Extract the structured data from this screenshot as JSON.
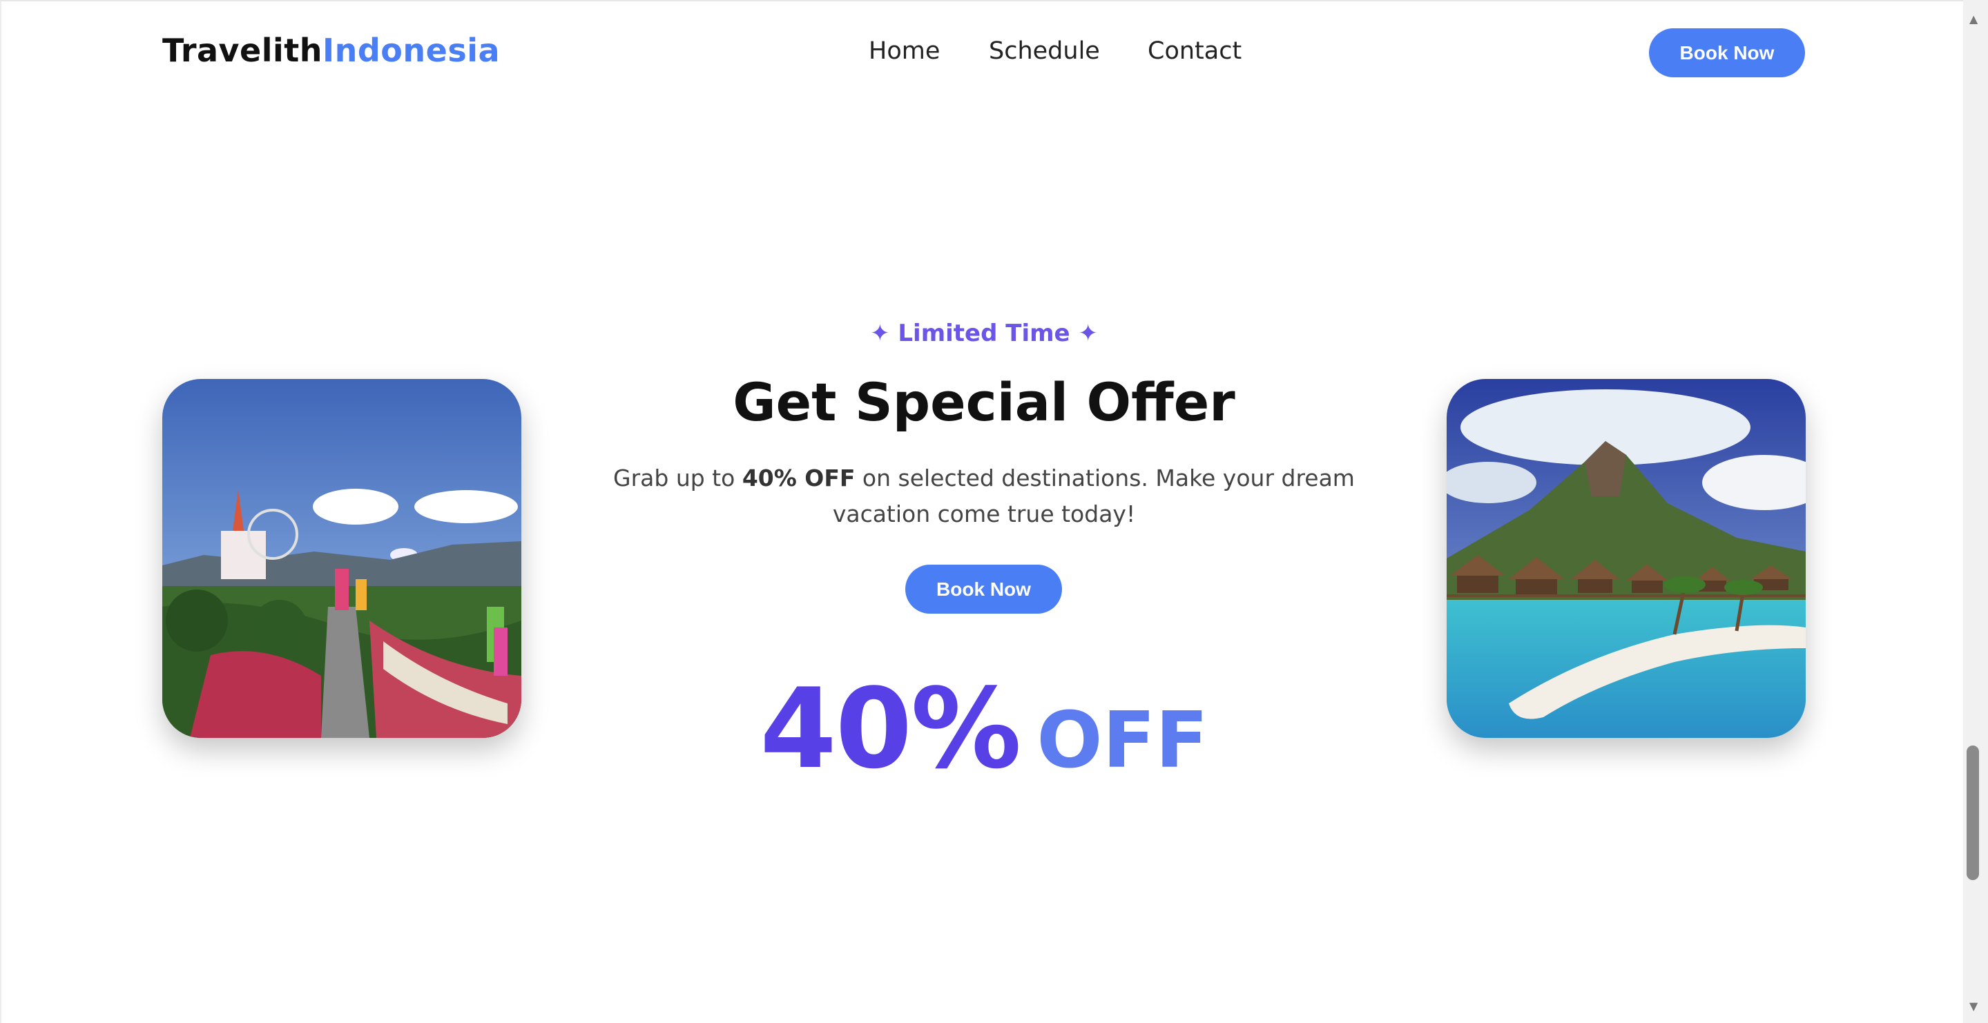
{
  "header": {
    "logo_part1": "Travelith",
    "logo_part2": "Indonesia",
    "nav": [
      "Home",
      "Schedule",
      "Contact"
    ],
    "cta_label": "Book Now"
  },
  "offer": {
    "eyebrow": "✦ Limited Time ✦",
    "title": "Get Special Offer",
    "desc_prefix": "Grab up to ",
    "desc_bold": "40% OFF",
    "desc_suffix": " on selected destinations. Make your dream vacation come true today!",
    "button_label": "Book Now",
    "big_percent": "40%",
    "big_off": "OFF"
  },
  "colors": {
    "accent": "#4a7ef5",
    "purple": "#5740e6",
    "eyebrow": "#6a55e8"
  },
  "icons": {
    "scroll_up": "▲",
    "scroll_down": "▼"
  }
}
